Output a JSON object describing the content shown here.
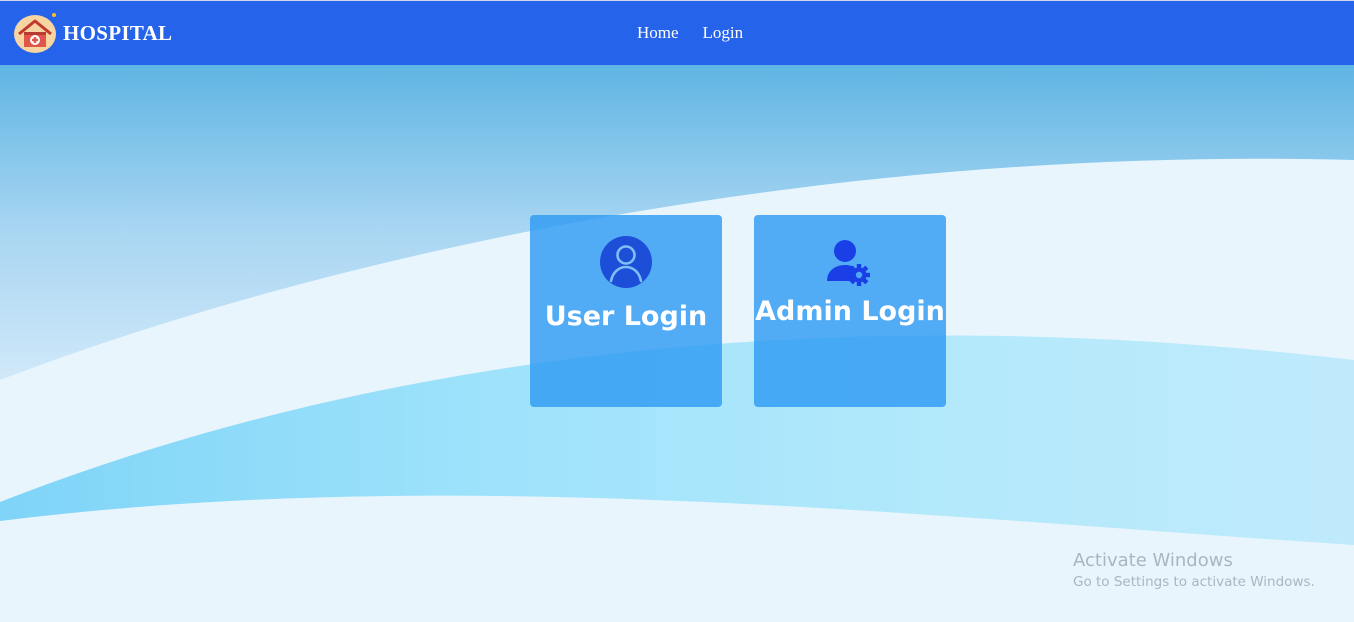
{
  "brand": {
    "name": "HOSPITAL",
    "logo_icon": "hospital-house-icon"
  },
  "nav": {
    "items": [
      {
        "label": "Home"
      },
      {
        "label": "Login"
      }
    ]
  },
  "cards": {
    "user": {
      "label": "User Login",
      "icon": "user-circle-icon"
    },
    "admin": {
      "label": "Admin Login",
      "icon": "user-gear-icon"
    }
  },
  "watermark": {
    "title": "Activate Windows",
    "subtitle": "Go to Settings to activate Windows."
  },
  "colors": {
    "navbar": "#2563eb",
    "card": "#2f9bf3",
    "user_icon": "#1d4ed8",
    "admin_icon": "#1a3fe6"
  }
}
